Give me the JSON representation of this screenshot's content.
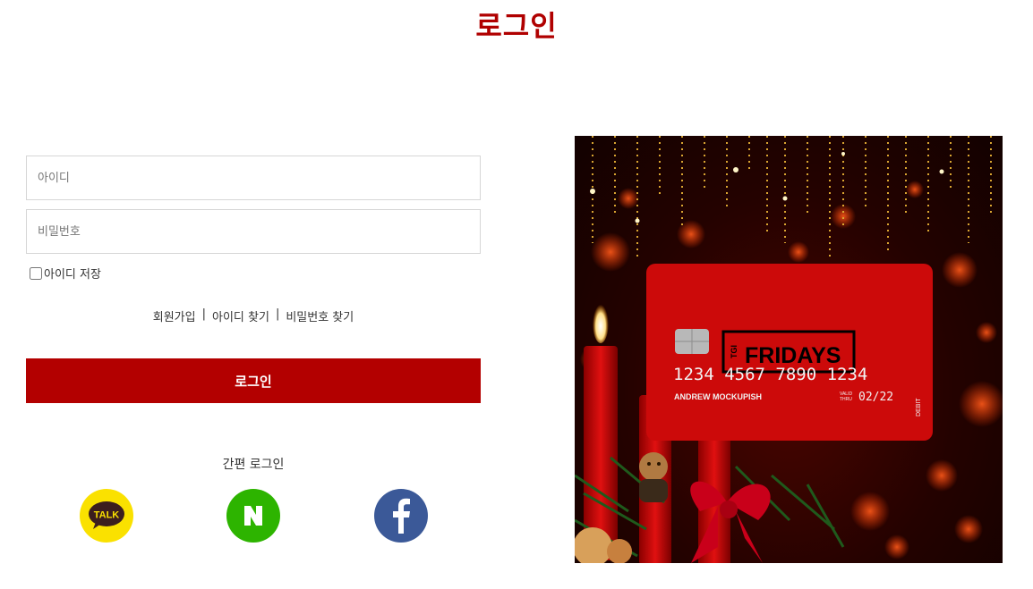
{
  "page": {
    "title": "로그인"
  },
  "form": {
    "id_placeholder": "아이디",
    "pw_placeholder": "비밀번호",
    "remember_label": "아이디 저장",
    "login_button": "로그인"
  },
  "links": {
    "signup": "회원가입",
    "find_id": "아이디 찾기",
    "find_pw": "비밀번호 찾기",
    "separator": "|"
  },
  "easy_login": {
    "label": "간편 로그인",
    "providers": [
      {
        "name": "kakao",
        "icon": "kakao-talk-icon",
        "text": "TALK",
        "color": "#fae100"
      },
      {
        "name": "naver",
        "icon": "naver-icon",
        "text": "N",
        "color": "#2db400"
      },
      {
        "name": "facebook",
        "icon": "facebook-icon",
        "text": "f",
        "color": "#3b5998"
      }
    ]
  },
  "promo": {
    "card_brand": "FRIDAYS",
    "card_brand_prefix": "TGI",
    "card_number": "1234 4567 7890 1234",
    "card_holder": "ANDREW MOCKUPISH",
    "valid_label_1": "VALID",
    "valid_label_2": "THRU",
    "expiry": "02/22",
    "card_type": "DEBIT"
  },
  "colors": {
    "accent": "#b00000",
    "button": "#b30000",
    "kakao": "#fae100",
    "naver": "#2db400",
    "facebook": "#3b5998"
  }
}
